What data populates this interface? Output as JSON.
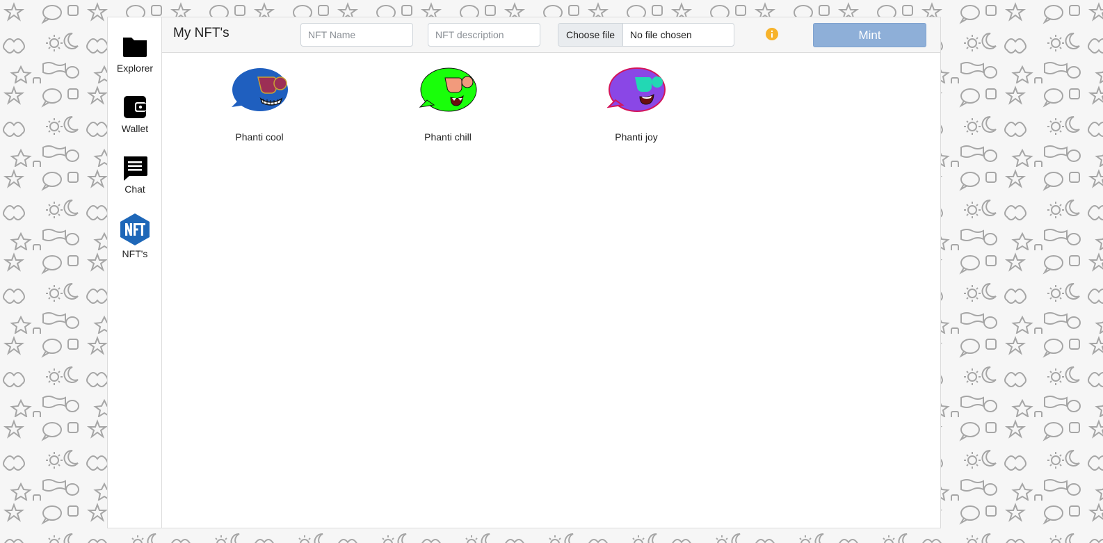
{
  "sidebar": {
    "items": [
      {
        "label": "Explorer",
        "icon": "folder-icon"
      },
      {
        "label": "Wallet",
        "icon": "wallet-icon"
      },
      {
        "label": "Chat",
        "icon": "chat-icon"
      },
      {
        "label": "NFT's",
        "icon": "nft-hexagon-icon"
      }
    ]
  },
  "toolbar": {
    "title": "My NFT's",
    "name_placeholder": "NFT Name",
    "description_placeholder": "NFT description",
    "file_button_label": "Choose file",
    "file_status": "No file chosen",
    "info_icon": "info-icon",
    "mint_label": "Mint"
  },
  "nfts": [
    {
      "name": "Phanti cool",
      "body_color": "#1f5fbf",
      "accent_color": "#9c2f55"
    },
    {
      "name": "Phanti chill",
      "body_color": "#19ff0a",
      "accent_color": "#f29a7c"
    },
    {
      "name": "Phanti joy",
      "body_color": "#8a47e6",
      "accent_color": "#22d8b4"
    }
  ],
  "colors": {
    "mint_button": "#8eafd8",
    "info_icon": "#f7b32b",
    "nft_logo": "#1e67b8"
  }
}
